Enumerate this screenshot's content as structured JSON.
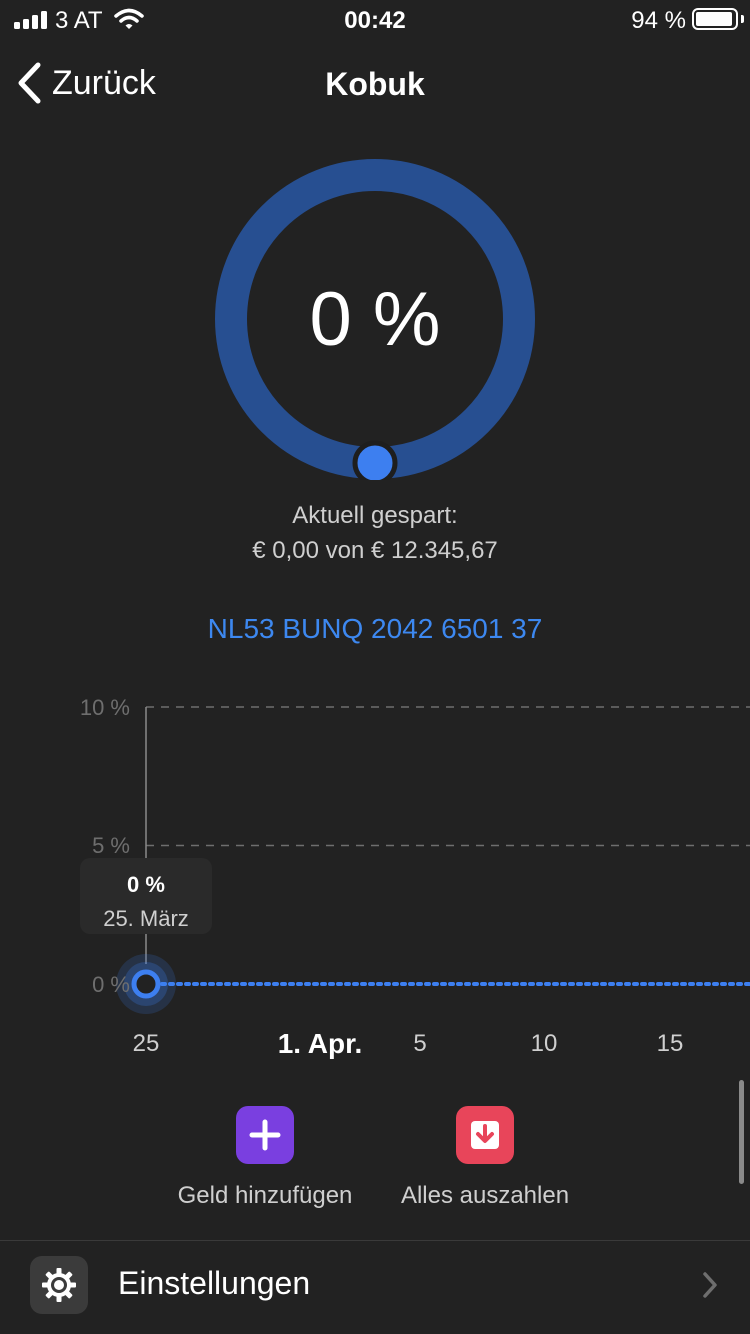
{
  "status_bar": {
    "carrier": "3 AT",
    "time": "00:42",
    "battery_percent": "94 %",
    "battery_level": 0.94
  },
  "nav": {
    "back_label": "Zurück",
    "title": "Kobuk"
  },
  "progress": {
    "value_text": "0 %",
    "fraction": 0
  },
  "savings": {
    "label": "Aktuell gespart:",
    "amount": "€ 0,00 von € 12.345,67"
  },
  "iban": "NL53 BUNQ 2042 6501 37",
  "chart_data": {
    "type": "line",
    "y_ticks": [
      "10 %",
      "5 %",
      "0 %"
    ],
    "ylim": [
      0,
      10
    ],
    "x_ticks": [
      "25",
      "1. Apr.",
      "5",
      "10",
      "15"
    ],
    "x_ticks_bold": [
      "1. Apr."
    ],
    "series": [
      {
        "points": [
          {
            "x": "25. März",
            "y": 0
          }
        ]
      }
    ],
    "tooltip": {
      "value": "0 %",
      "date": "25. März"
    },
    "accent_color": "#3d7ff0"
  },
  "actions": [
    {
      "label": "Geld hinzufügen",
      "icon": "plus-icon",
      "color": "#7a3fe0"
    },
    {
      "label": "Alles auszahlen",
      "icon": "download-icon",
      "color": "#e8455a"
    }
  ],
  "settings": {
    "label": "Einstellungen",
    "icon": "gear-icon"
  },
  "colors": {
    "background": "#222222",
    "ring": "#274f91",
    "accent": "#3d88f0"
  }
}
